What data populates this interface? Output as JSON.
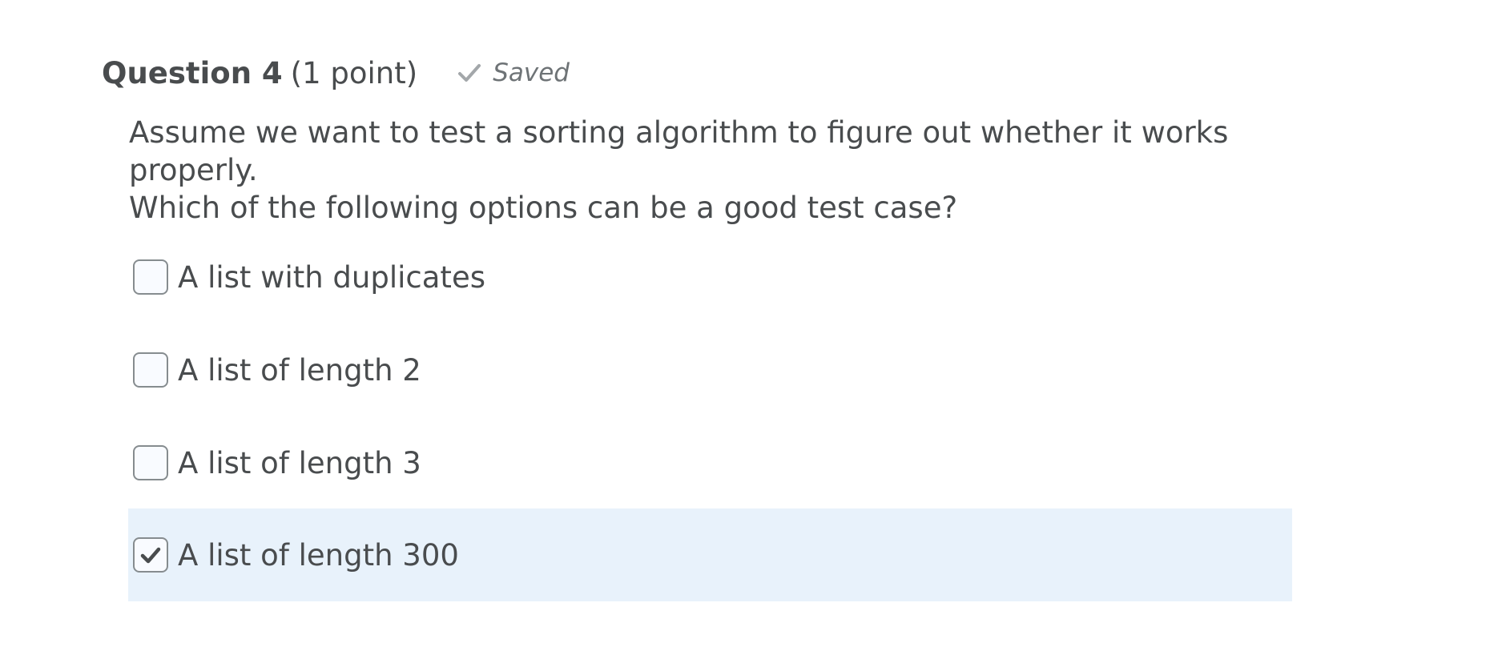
{
  "question": {
    "title": "Question 4",
    "points": "(1 point)",
    "status_icon": "check-icon",
    "status": "Saved",
    "prompt_line1": "Assume we want to test a sorting algorithm to figure out whether it works properly.",
    "prompt_line2": "Which of the following options can be a good test case?",
    "options": [
      {
        "label": "A list with duplicates",
        "checked": false
      },
      {
        "label": "A list of length 2",
        "checked": false
      },
      {
        "label": "A list of length 3",
        "checked": false
      },
      {
        "label": "A list of length 300",
        "checked": true
      }
    ]
  },
  "colors": {
    "text": "#494c4e",
    "muted": "#6e7376",
    "selected_bg": "#e8f2fb",
    "checkbox_border": "#868c8f"
  }
}
